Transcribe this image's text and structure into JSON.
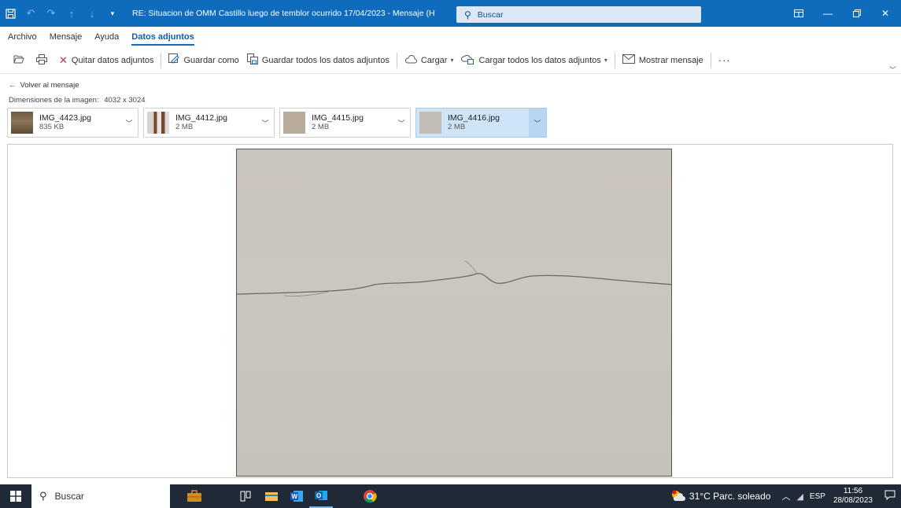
{
  "titlebar": {
    "title": "RE: Situacion de OMM Castillo luego de temblor ocurrido 17/04/2023  -  Mensaje (HT...",
    "search_label": "Buscar",
    "colors": {
      "accent": "#0f6cbd"
    }
  },
  "menu": {
    "items": [
      {
        "label": "Archivo"
      },
      {
        "label": "Mensaje"
      },
      {
        "label": "Ayuda"
      },
      {
        "label": "Datos adjuntos"
      }
    ]
  },
  "ribbon": {
    "remove_label": "Quitar datos adjuntos",
    "save_as_label": "Guardar como",
    "save_all_label": "Guardar todos los datos adjuntos",
    "upload_label": "Cargar",
    "upload_all_label": "Cargar todos los datos adjuntos",
    "show_message_label": "Mostrar mensaje",
    "more_label": "···"
  },
  "back_label": "Volver al mensaje",
  "dimensions": {
    "label": "Dimensiones de la imagen:",
    "value": "4032 x 3024"
  },
  "attachments": [
    {
      "name": "IMG_4423.jpg",
      "size": "835 KB",
      "selected": false
    },
    {
      "name": "IMG_4412.jpg",
      "size": "2 MB",
      "selected": false
    },
    {
      "name": "IMG_4415.jpg",
      "size": "2 MB",
      "selected": false
    },
    {
      "name": "IMG_4416.jpg",
      "size": "2 MB",
      "selected": true
    }
  ],
  "taskbar": {
    "search_label": "Buscar",
    "weather": "31°C  Parc. soleado",
    "language": "ESP",
    "time": "11:56",
    "date": "28/08/2023"
  }
}
